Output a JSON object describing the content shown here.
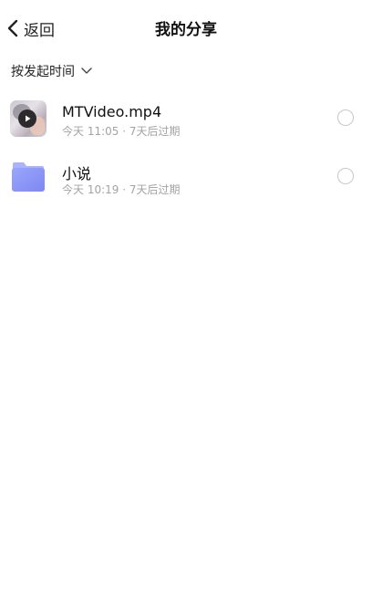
{
  "header": {
    "back_label": "返回",
    "title": "我的分享"
  },
  "sort": {
    "label": "按发起时间"
  },
  "shares": [
    {
      "name": "MTVideo.mp4",
      "meta": "今天 11:05 · 7天后过期",
      "type": "video",
      "selected": false
    },
    {
      "name": "小说",
      "meta": "今天 10:19 · 7天后过期",
      "type": "folder",
      "selected": false
    }
  ],
  "colors": {
    "folder": "#8f98f7",
    "meta_text": "#a3a3a3"
  }
}
